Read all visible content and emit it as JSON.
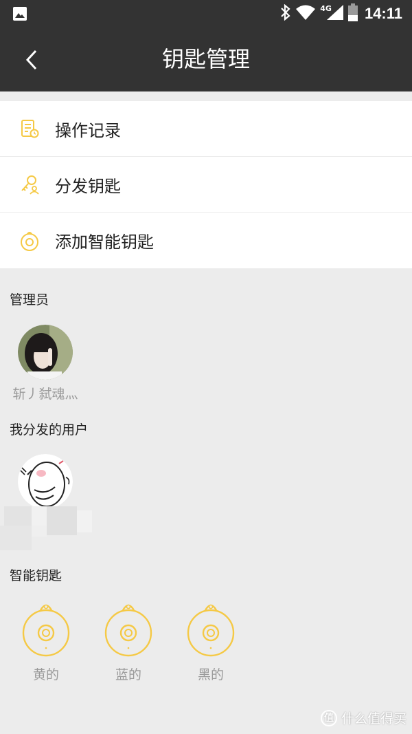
{
  "status_bar": {
    "time": "14:11",
    "network": "4G",
    "icons": [
      "gallery-icon",
      "bluetooth-icon",
      "wifi-icon",
      "signal-icon",
      "battery-icon"
    ]
  },
  "app_bar": {
    "title": "钥匙管理",
    "back_icon": "chevron-left-icon"
  },
  "menu": {
    "items": [
      {
        "label": "操作记录",
        "icon": "record-icon"
      },
      {
        "label": "分发钥匙",
        "icon": "share-key-icon"
      },
      {
        "label": "添加智能钥匙",
        "icon": "smart-key-icon"
      }
    ]
  },
  "admin_section": {
    "title": "管理员",
    "name": "斩丿弑魂灬"
  },
  "users_section": {
    "title": "我分发的用户"
  },
  "keys_section": {
    "title": "智能钥匙",
    "keys": [
      {
        "label": "黄的"
      },
      {
        "label": "蓝的"
      },
      {
        "label": "黑的"
      }
    ]
  },
  "watermark": {
    "badge": "值",
    "text": "什么值得买"
  },
  "colors": {
    "bar": "#333333",
    "accent": "#f5c945",
    "background": "#ececec",
    "muted_text": "#9a9a9a"
  }
}
